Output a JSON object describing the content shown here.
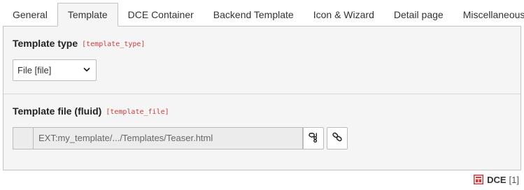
{
  "tabs": [
    {
      "label": "General"
    },
    {
      "label": "Template"
    },
    {
      "label": "DCE Container"
    },
    {
      "label": "Backend Template"
    },
    {
      "label": "Icon & Wizard"
    },
    {
      "label": "Detail page"
    },
    {
      "label": "Miscellaneous"
    }
  ],
  "active_tab": "Template",
  "template_type": {
    "label": "Template type",
    "field_name": "[template_type]",
    "selected_value": "File [file]"
  },
  "template_file": {
    "label": "Template file (fluid)",
    "field_name": "[template_file]",
    "value": "EXT:my_template/.../Templates/Teaser.html"
  },
  "icons": {
    "select_chevron": "chevron-down-icon",
    "wizard": "wizard-icon",
    "link": "link-icon",
    "record": "dce-record-icon"
  },
  "footer": {
    "record_name": "DCE",
    "record_uid": "[1]"
  },
  "colors": {
    "field_name": "#c83c3c",
    "record_icon": "#c83c3c",
    "panel_background": "#f5f5f5"
  }
}
